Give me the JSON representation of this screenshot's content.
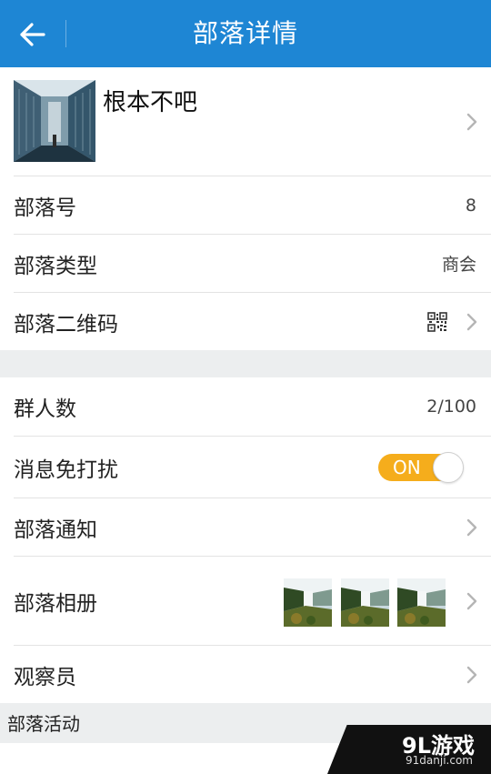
{
  "header": {
    "title": "部落详情",
    "back_icon": "arrow-left-icon",
    "background_color": "#1e86d4"
  },
  "profile": {
    "name": "根本不吧",
    "avatar": "building-photo"
  },
  "info": {
    "tribe_id_label": "部落号",
    "tribe_id_value": "8",
    "tribe_type_label": "部落类型",
    "tribe_type_value": "商会",
    "qr_label": "部落二维码",
    "qr_icon": "qr-code-icon"
  },
  "settings": {
    "member_count_label": "群人数",
    "member_count_value": "2/100",
    "mute_label": "消息免打扰",
    "mute_toggle_text": "ON",
    "mute_on": true,
    "toggle_color": "#f5ad1c",
    "notice_label": "部落通知",
    "album_label": "部落相册",
    "album_thumbnails": [
      "waterfall-photo-1",
      "waterfall-photo-2",
      "waterfall-photo-3"
    ],
    "observer_label": "观察员"
  },
  "activity": {
    "section_label": "部落活动"
  },
  "watermark": {
    "logo": "9L游戏",
    "url": "91danji.com"
  }
}
